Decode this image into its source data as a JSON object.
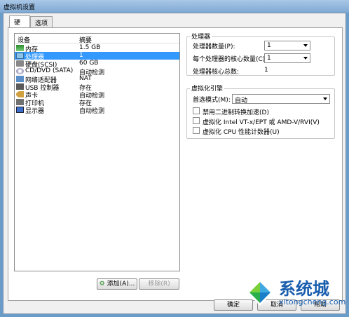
{
  "window": {
    "title": "虚拟机设置"
  },
  "tabs": [
    {
      "label": "硬件"
    },
    {
      "label": "选项"
    }
  ],
  "device_list": {
    "headers": {
      "device": "设备",
      "summary": "摘要"
    },
    "rows": [
      {
        "name": "内存",
        "summary": "1.5 GB",
        "icon": "memory-icon"
      },
      {
        "name": "处理器",
        "summary": "1",
        "icon": "processor-icon"
      },
      {
        "name": "硬盘(SCSI)",
        "summary": "60 GB",
        "icon": "hard-disk-icon"
      },
      {
        "name": "CD/DVD (SATA)",
        "summary": "自动检测",
        "icon": "cd-dvd-icon"
      },
      {
        "name": "网络适配器",
        "summary": "NAT",
        "icon": "network-adapter-icon"
      },
      {
        "name": "USB 控制器",
        "summary": "存在",
        "icon": "usb-icon"
      },
      {
        "name": "声卡",
        "summary": "自动检测",
        "icon": "sound-icon"
      },
      {
        "name": "打印机",
        "summary": "存在",
        "icon": "printer-icon"
      },
      {
        "name": "显示器",
        "summary": "自动检测",
        "icon": "display-icon"
      }
    ],
    "selected_index": 1
  },
  "buttons": {
    "add": "添加(A)...",
    "remove": "移除(R)",
    "ok": "确定",
    "cancel": "取消",
    "help": "帮助"
  },
  "processor": {
    "group_title": "处理器",
    "count_label": "处理器数量(P):",
    "count_value": "1",
    "cores_label": "每个处理器的核心数量(C):",
    "cores_value": "1",
    "total_label": "处理器核心总数:",
    "total_value": "1"
  },
  "virtualization": {
    "group_title": "虚拟化引擎",
    "mode_label": "首选模式(M):",
    "mode_value": "自动",
    "options": [
      {
        "label": "禁用二进制转换加速(D)",
        "checked": false
      },
      {
        "label": "虚拟化 Intel VT-x/EPT 或 AMD-V/RVI(V)",
        "checked": false
      },
      {
        "label": "虚拟化 CPU 性能计数器(U)",
        "checked": false
      }
    ]
  },
  "watermark": {
    "brand": "系统城",
    "domain": "xitongcheng.com"
  }
}
